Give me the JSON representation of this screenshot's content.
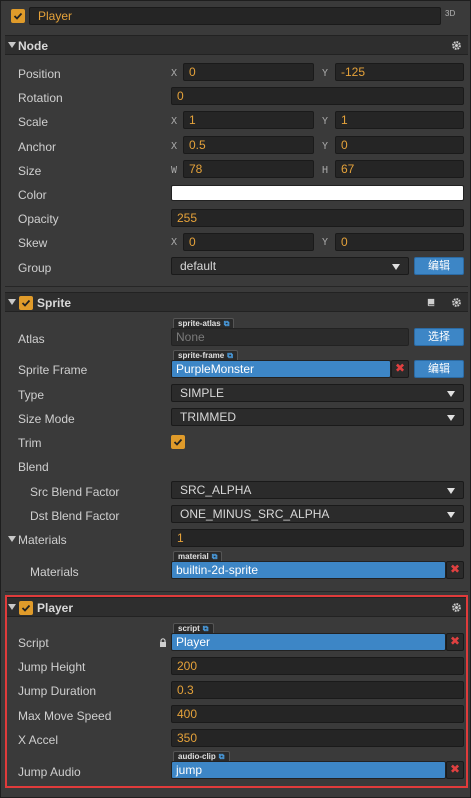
{
  "header": {
    "node_name": "Player",
    "badge_3d": "3D"
  },
  "node": {
    "title": "Node",
    "position": {
      "label": "Position",
      "x_axis": "X",
      "x": "0",
      "y_axis": "Y",
      "y": "-125"
    },
    "rotation": {
      "label": "Rotation",
      "value": "0"
    },
    "scale": {
      "label": "Scale",
      "x_axis": "X",
      "x": "1",
      "y_axis": "Y",
      "y": "1"
    },
    "anchor": {
      "label": "Anchor",
      "x_axis": "X",
      "x": "0.5",
      "y_axis": "Y",
      "y": "0"
    },
    "size": {
      "label": "Size",
      "w_axis": "W",
      "w": "78",
      "h_axis": "H",
      "h": "67"
    },
    "color": {
      "label": "Color",
      "value": "#ffffff"
    },
    "opacity": {
      "label": "Opacity",
      "value": "255"
    },
    "skew": {
      "label": "Skew",
      "x_axis": "X",
      "x": "0",
      "y_axis": "Y",
      "y": "0"
    },
    "group": {
      "label": "Group",
      "value": "default",
      "edit_label": "编辑"
    }
  },
  "sprite": {
    "title": "Sprite",
    "atlas": {
      "label": "Atlas",
      "tag": "sprite-atlas",
      "value": "None",
      "button": "选择"
    },
    "sprite_frame": {
      "label": "Sprite Frame",
      "tag": "sprite-frame",
      "value": "PurpleMonster",
      "button": "编辑"
    },
    "type": {
      "label": "Type",
      "value": "SIMPLE"
    },
    "size_mode": {
      "label": "Size Mode",
      "value": "TRIMMED"
    },
    "trim": {
      "label": "Trim",
      "checked": true
    },
    "blend": {
      "label": "Blend"
    },
    "src_blend": {
      "label": "Src Blend Factor",
      "value": "SRC_ALPHA"
    },
    "dst_blend": {
      "label": "Dst Blend Factor",
      "value": "ONE_MINUS_SRC_ALPHA"
    },
    "materials_count": {
      "label": "Materials",
      "value": "1"
    },
    "materials_item": {
      "label": "Materials",
      "tag": "material",
      "value": "builtin-2d-sprite"
    }
  },
  "player": {
    "title": "Player",
    "script": {
      "label": "Script",
      "tag": "script",
      "value": "Player"
    },
    "jump_height": {
      "label": "Jump Height",
      "value": "200"
    },
    "jump_duration": {
      "label": "Jump Duration",
      "value": "0.3"
    },
    "max_move_speed": {
      "label": "Max Move Speed",
      "value": "400"
    },
    "x_accel": {
      "label": "X Accel",
      "value": "350"
    },
    "jump_audio": {
      "label": "Jump Audio",
      "tag": "audio-clip",
      "value": "jump"
    }
  },
  "colors": {
    "accent": "#e09b2a",
    "blue": "#3d86c6",
    "highlight": "#e03b3b",
    "remove": "#e04040"
  }
}
